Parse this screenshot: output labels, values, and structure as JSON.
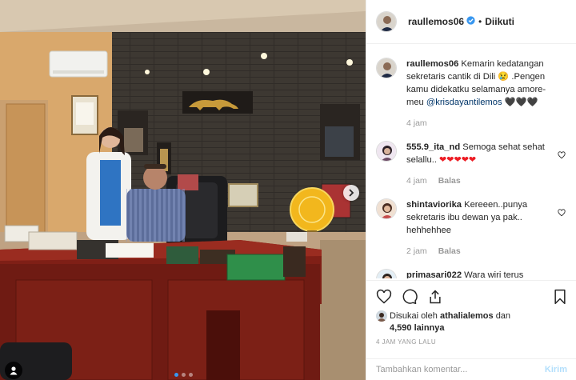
{
  "post": {
    "image_alt": "",
    "carousel": {
      "total": 3,
      "active": 0
    }
  },
  "header": {
    "username": "raullemos06",
    "verified": true,
    "separator": "•",
    "follow_label": "Diikuti"
  },
  "caption": {
    "username": "raullemos06",
    "text_before": "Kemarin kedatangan sekretaris cantik di Dili 😢 .Pengen kamu didekatku selamanya amore-meu ",
    "mention": "@krisdayantilemos",
    "text_after": " 🖤🖤🖤",
    "time": "4 jam"
  },
  "comments": [
    {
      "username": "555.9_ita_nd",
      "text": "Semoga sehat sehat selallu..",
      "hearts": "❤❤❤❤❤",
      "time": "4 jam",
      "reply": "Balas"
    },
    {
      "username": "shintaviorika",
      "text": "Kereeen..punya sekretaris ibu dewan ya pak.. hehhehhee",
      "time": "2 jam",
      "reply": "Balas"
    },
    {
      "username": "primasari022",
      "text": "Wara wiri terus"
    }
  ],
  "likes": {
    "prefix": "Disukai oleh",
    "liker": "athalialemos",
    "and": "dan",
    "others_count": "4,590",
    "others_label": "lainnya"
  },
  "timestamp": "4 JAM YANG LALU",
  "comment_box": {
    "placeholder": "Tambahkan komentar...",
    "post_label": "Kirim"
  },
  "colors": {
    "accent": "#3897f0",
    "text": "#262626",
    "muted": "#999999",
    "verified": "#3897f0",
    "heart": "#ed4956"
  }
}
